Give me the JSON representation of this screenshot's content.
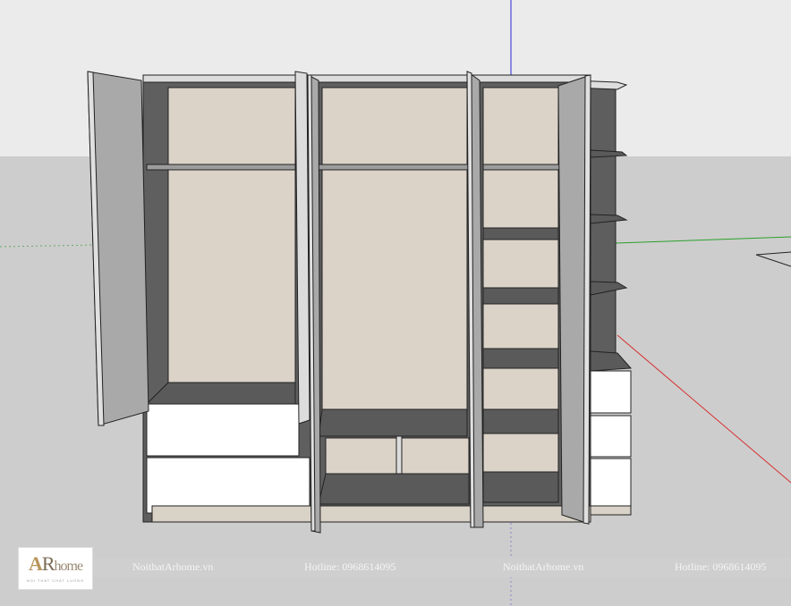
{
  "logo": {
    "letters_a": "A",
    "letters_r": "R",
    "letters_home": "home",
    "tagline": "NOI THAT CHAT LUONG"
  },
  "footer": {
    "items": [
      "NoithatArhome.vn",
      "Hotline: 0968614095",
      "NoithatArhome.vn",
      "Hotline: 0968614095"
    ]
  },
  "colors": {
    "sky": "#e8e8e8",
    "ground": "#cfcfcf",
    "panel_dark": "#656565",
    "door_grey": "#a8a8a8",
    "wood": "#dcd5cb",
    "drawer_white": "#ffffff",
    "axis_red": "#d63030",
    "axis_green": "#2aa02a",
    "axis_blue": "#2a2ad0"
  }
}
